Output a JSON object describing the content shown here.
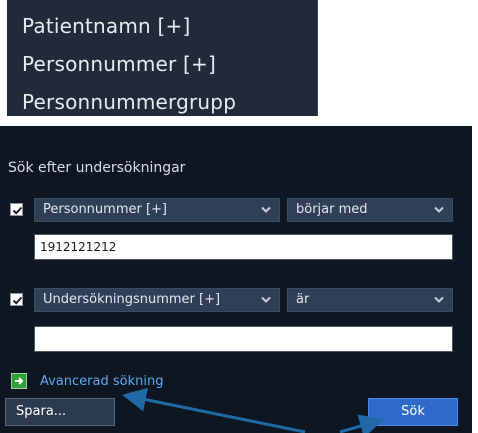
{
  "dropdown_list": {
    "items": [
      "Patientnamn [+]",
      "Personnummer [+]",
      "Personnummergrupp"
    ]
  },
  "panel": {
    "title": "Sök efter undersökningar",
    "criteria": [
      {
        "checked": true,
        "field": "Personnummer [+]",
        "operator": "börjar med",
        "value": "1912121212"
      },
      {
        "checked": true,
        "field": "Undersökningsnummer [+]",
        "operator": "är",
        "value": ""
      }
    ],
    "advanced_search_label": "Avancerad sökning",
    "save_label": "Spara...",
    "search_label": "Sök"
  },
  "colors": {
    "panel_bg": "#0e1622",
    "select_bg": "#2f3f55",
    "link": "#5ea9ee",
    "search_button": "#2f6ac8",
    "annotation_arrow": "#1e6aa7"
  },
  "icons": {
    "checkbox_check": "check-icon",
    "select_chevron": "chevron-down-icon",
    "advanced": "arrow-right-box-icon"
  }
}
